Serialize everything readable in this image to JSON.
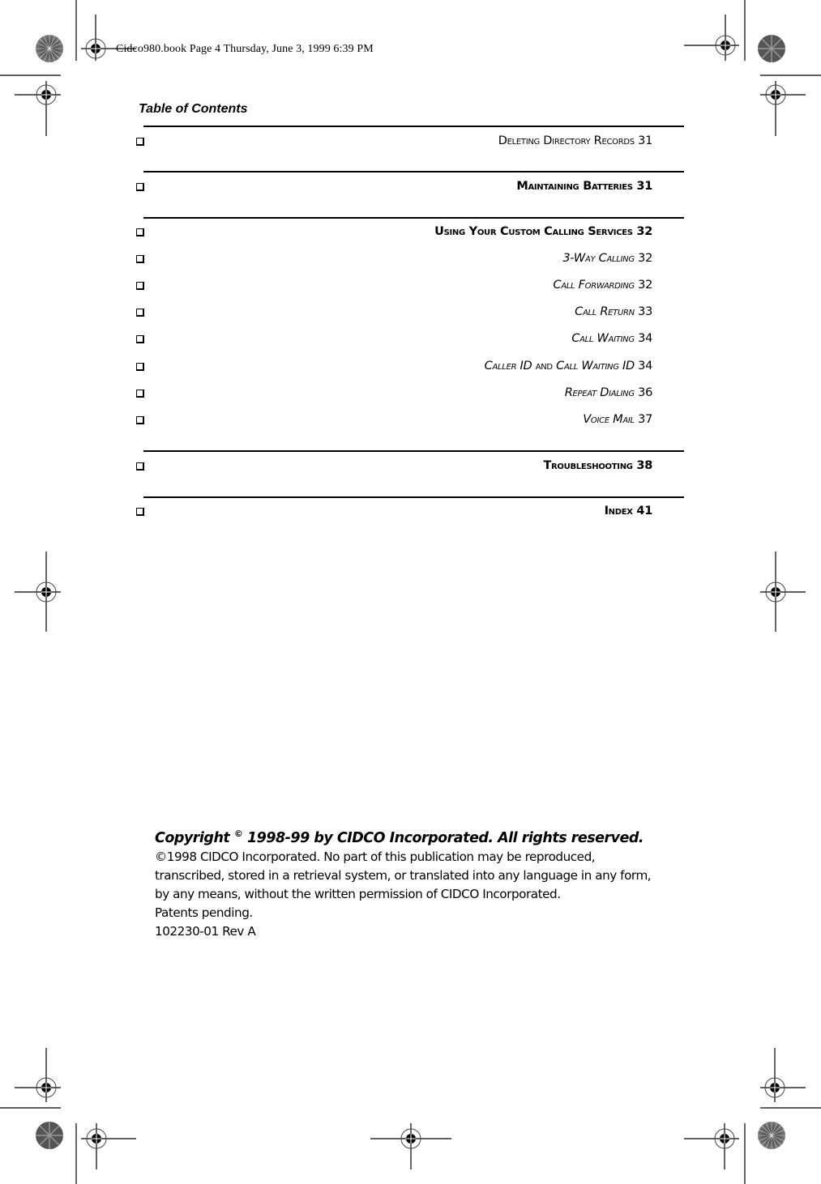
{
  "slug": "Cidco980.book  Page 4  Thursday, June 3, 1999  6:39 PM",
  "header": {
    "title": "Table of Contents"
  },
  "toc": {
    "entries": [
      {
        "parts": [
          {
            "t": "Deleting Directory Records",
            "style": "sc"
          },
          {
            "t": " 31",
            "style": ""
          }
        ],
        "level": 1,
        "weight": "normal",
        "rule_before": true
      },
      {
        "parts": [
          {
            "t": "Maintaining Batteries",
            "style": "sc"
          },
          {
            "t": " 31",
            "style": ""
          }
        ],
        "level": 1,
        "weight": "bold",
        "rule_before": true
      },
      {
        "parts": [
          {
            "t": "Using Your Custom Calling Services",
            "style": "sc"
          },
          {
            "t": " 32",
            "style": ""
          }
        ],
        "level": 1,
        "weight": "bold",
        "rule_before": true
      },
      {
        "parts": [
          {
            "t": "3-Way Calling",
            "style": "sc ital"
          },
          {
            "t": " 32",
            "style": ""
          }
        ],
        "level": 2,
        "weight": "normal",
        "rule_before": false
      },
      {
        "parts": [
          {
            "t": "Call Forwarding",
            "style": "sc ital"
          },
          {
            "t": " 32",
            "style": ""
          }
        ],
        "level": 2,
        "weight": "normal",
        "rule_before": false
      },
      {
        "parts": [
          {
            "t": "Call Return",
            "style": "sc ital"
          },
          {
            "t": " 33",
            "style": ""
          }
        ],
        "level": 2,
        "weight": "normal",
        "rule_before": false
      },
      {
        "parts": [
          {
            "t": "Call Waiting",
            "style": "sc ital"
          },
          {
            "t": " 34",
            "style": ""
          }
        ],
        "level": 2,
        "weight": "normal",
        "rule_before": false
      },
      {
        "parts": [
          {
            "t": "Caller ID",
            "style": "sc ital"
          },
          {
            "t": " and ",
            "style": "sc"
          },
          {
            "t": "Call Waiting ID",
            "style": "sc ital"
          },
          {
            "t": " 34",
            "style": ""
          }
        ],
        "level": 2,
        "weight": "normal",
        "rule_before": false
      },
      {
        "parts": [
          {
            "t": "Repeat Dialing",
            "style": "sc ital"
          },
          {
            "t": "  36",
            "style": ""
          }
        ],
        "level": 2,
        "weight": "normal",
        "rule_before": false
      },
      {
        "parts": [
          {
            "t": "Voice Mail",
            "style": "sc ital"
          },
          {
            "t": " 37",
            "style": ""
          }
        ],
        "level": 2,
        "weight": "normal",
        "rule_before": false
      },
      {
        "parts": [
          {
            "t": "Troubleshooting",
            "style": "sc"
          },
          {
            "t": " 38",
            "style": ""
          }
        ],
        "level": 1,
        "weight": "bold",
        "rule_before": true
      },
      {
        "parts": [
          {
            "t": "Index",
            "style": "sc"
          },
          {
            "t": " 41",
            "style": ""
          }
        ],
        "level": 1,
        "weight": "bold",
        "rule_before": true
      }
    ]
  },
  "copyright": {
    "heading_pre": "Copyright ",
    "heading_symbol": "©",
    "heading_post": " 1998-99 by CIDCO Incorporated. All rights reserved.",
    "lines": [
      "©1998 CIDCO Incorporated. No part of this publication may be reproduced,",
      "transcribed, stored in a retrieval system, or translated into any language in any form,",
      "by any means, without the written permission of CIDCO Incorporated.",
      "Patents pending.",
      "102230-01 Rev A"
    ]
  },
  "icons": {
    "checkbox": "checkbox-icon",
    "registration_mark": "registration-mark-icon",
    "starburst": "starburst-target-icon"
  }
}
